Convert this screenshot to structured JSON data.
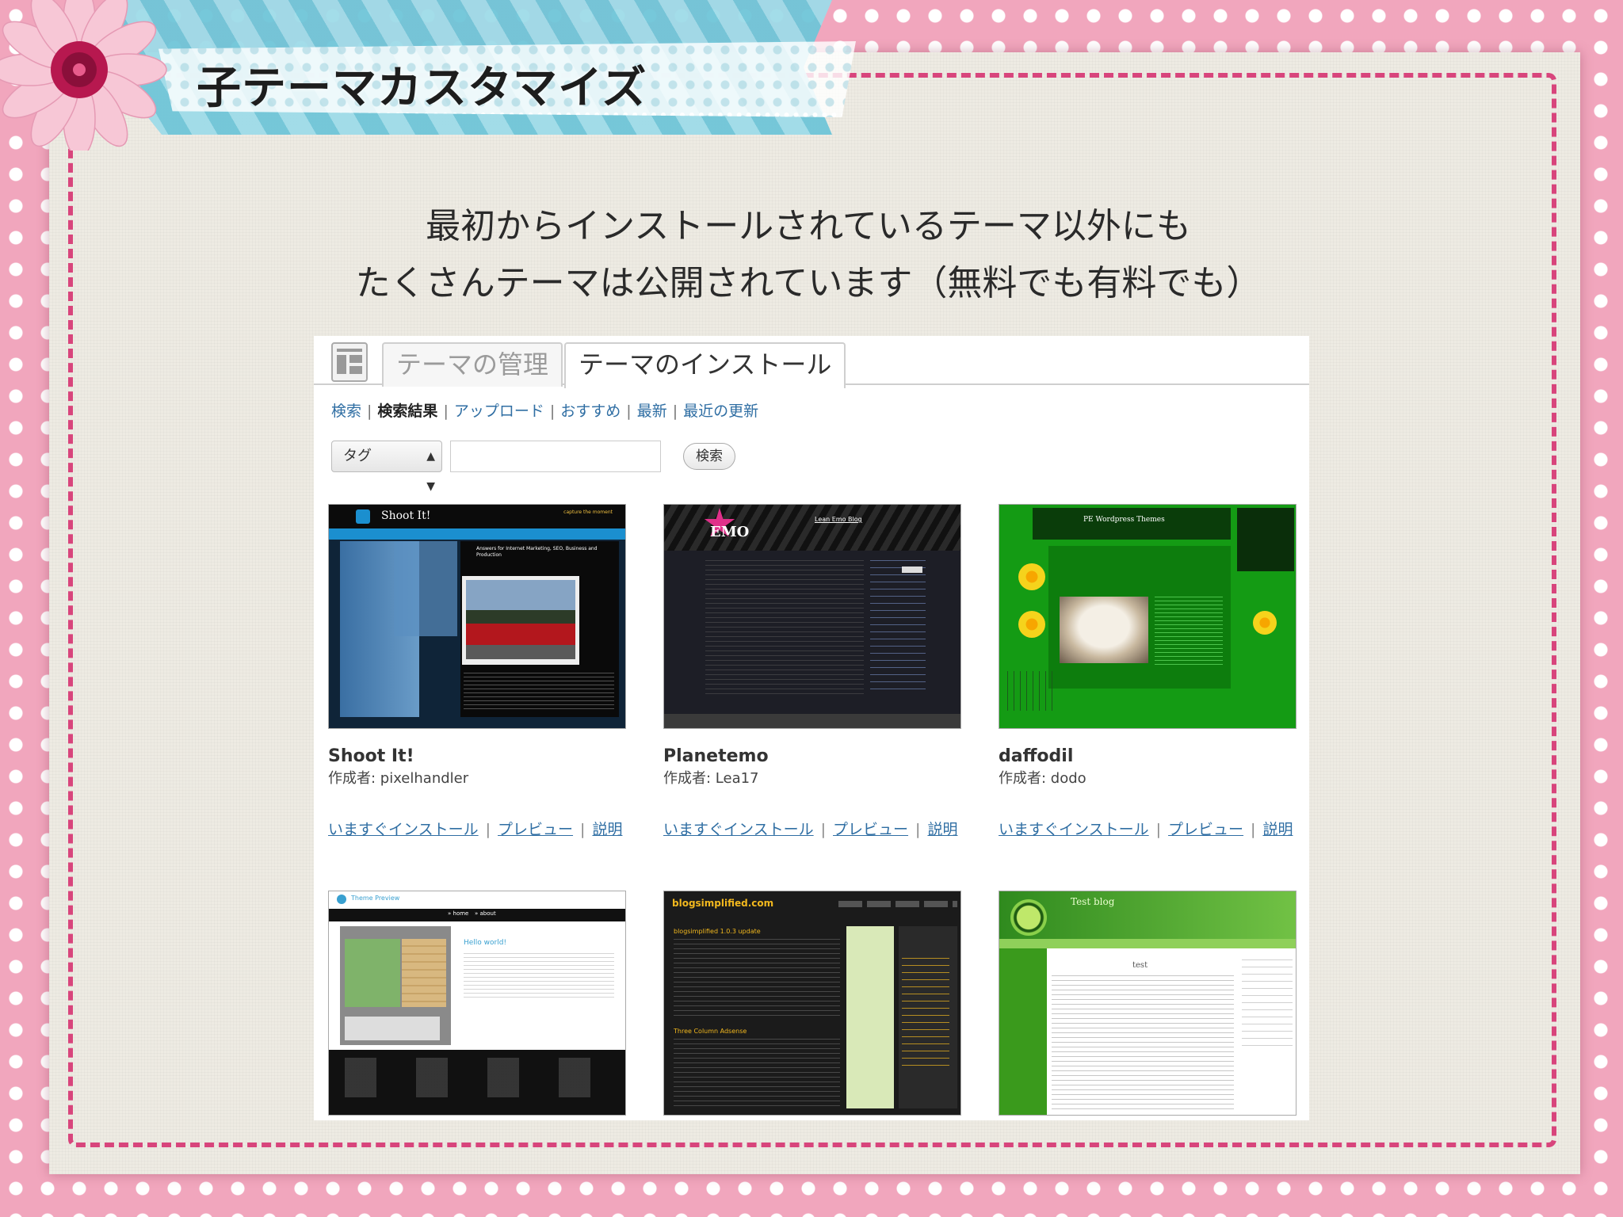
{
  "slide": {
    "title": "子テーマカスタマイズ",
    "lines": [
      "最初からインストールされているテーマ以外にも",
      "たくさんテーマは公開されています（無料でも有料でも）"
    ]
  },
  "wp": {
    "tabs": {
      "manage": "テーマの管理",
      "install": "テーマのインストール"
    },
    "subnav": [
      {
        "label": "検索",
        "current": false
      },
      {
        "label": "検索結果",
        "current": true
      },
      {
        "label": "アップロード",
        "current": false
      },
      {
        "label": "おすすめ",
        "current": false
      },
      {
        "label": "最新",
        "current": false
      },
      {
        "label": "最近の更新",
        "current": false
      }
    ],
    "search": {
      "select_value": "タグ",
      "input_value": "",
      "button_label": "検索"
    },
    "link_labels": {
      "install": "いますぐインストール",
      "preview": "プレビュー",
      "details": "説明"
    },
    "themes": [
      {
        "name": "Shoot It!",
        "author": "作成者: pixelhandler",
        "thumb": {
          "header_text": "Shoot It!",
          "sub_text": "capture the moment",
          "post_title": "Answers for Internet Marketing, SEO, Business and Production",
          "accent": "#1b8fcf",
          "bg": "#0f2438"
        }
      },
      {
        "name": "Planetemo",
        "author": "作成者: Lea17",
        "thumb": {
          "header_text": "Lean Emo Blog",
          "logo": "EMO",
          "accent": "#e0308a",
          "bg": "#1d1e26"
        }
      },
      {
        "name": "daffodil",
        "author": "作成者: dodo",
        "thumb": {
          "header_text": "PE Wordpress Themes",
          "accent": "#f5d31c",
          "bg": "#149b14"
        }
      },
      {
        "thumb": {
          "header_text": "Theme Preview",
          "post_title": "Hello world!",
          "tabs": [
            "» home",
            "» about"
          ],
          "accent": "#39a0d0",
          "bg": "#ffffff"
        }
      },
      {
        "thumb": {
          "header_text": "blogsimplified.com",
          "post_title": "blogsimplified 1.0.3 update",
          "post_title_2": "Three Column Adsense",
          "accent": "#f2b81e",
          "bg": "#1b1b1b"
        }
      },
      {
        "thumb": {
          "header_text": "Test blog",
          "post_title": "test",
          "accent": "#4aa32a",
          "bg": "#ffffff"
        }
      }
    ]
  }
}
